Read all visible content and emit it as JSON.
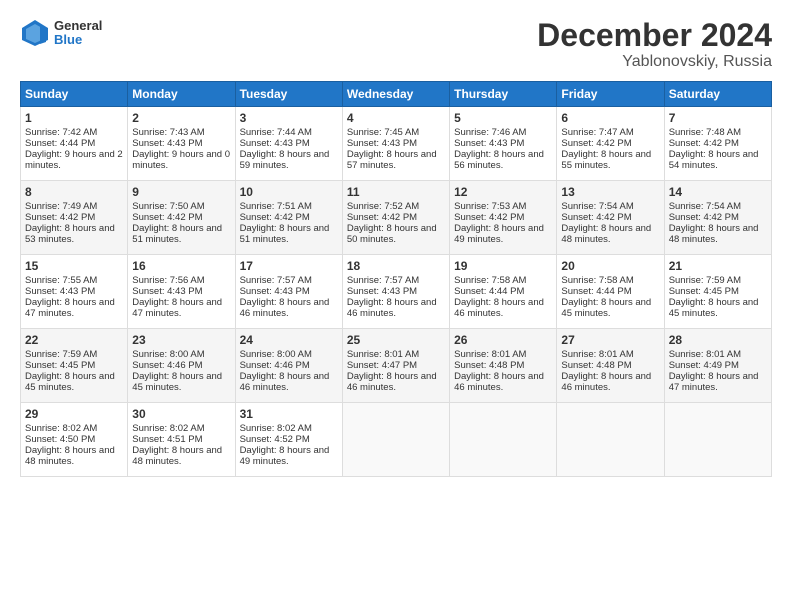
{
  "logo": {
    "line1": "General",
    "line2": "Blue"
  },
  "title": "December 2024",
  "location": "Yablonovskiy, Russia",
  "headers": [
    "Sunday",
    "Monday",
    "Tuesday",
    "Wednesday",
    "Thursday",
    "Friday",
    "Saturday"
  ],
  "weeks": [
    [
      {
        "day": "1",
        "sunrise": "7:42 AM",
        "sunset": "4:44 PM",
        "daylight": "9 hours and 2 minutes."
      },
      {
        "day": "2",
        "sunrise": "7:43 AM",
        "sunset": "4:43 PM",
        "daylight": "9 hours and 0 minutes."
      },
      {
        "day": "3",
        "sunrise": "7:44 AM",
        "sunset": "4:43 PM",
        "daylight": "8 hours and 59 minutes."
      },
      {
        "day": "4",
        "sunrise": "7:45 AM",
        "sunset": "4:43 PM",
        "daylight": "8 hours and 57 minutes."
      },
      {
        "day": "5",
        "sunrise": "7:46 AM",
        "sunset": "4:43 PM",
        "daylight": "8 hours and 56 minutes."
      },
      {
        "day": "6",
        "sunrise": "7:47 AM",
        "sunset": "4:42 PM",
        "daylight": "8 hours and 55 minutes."
      },
      {
        "day": "7",
        "sunrise": "7:48 AM",
        "sunset": "4:42 PM",
        "daylight": "8 hours and 54 minutes."
      }
    ],
    [
      {
        "day": "8",
        "sunrise": "7:49 AM",
        "sunset": "4:42 PM",
        "daylight": "8 hours and 53 minutes."
      },
      {
        "day": "9",
        "sunrise": "7:50 AM",
        "sunset": "4:42 PM",
        "daylight": "8 hours and 51 minutes."
      },
      {
        "day": "10",
        "sunrise": "7:51 AM",
        "sunset": "4:42 PM",
        "daylight": "8 hours and 51 minutes."
      },
      {
        "day": "11",
        "sunrise": "7:52 AM",
        "sunset": "4:42 PM",
        "daylight": "8 hours and 50 minutes."
      },
      {
        "day": "12",
        "sunrise": "7:53 AM",
        "sunset": "4:42 PM",
        "daylight": "8 hours and 49 minutes."
      },
      {
        "day": "13",
        "sunrise": "7:54 AM",
        "sunset": "4:42 PM",
        "daylight": "8 hours and 48 minutes."
      },
      {
        "day": "14",
        "sunrise": "7:54 AM",
        "sunset": "4:42 PM",
        "daylight": "8 hours and 48 minutes."
      }
    ],
    [
      {
        "day": "15",
        "sunrise": "7:55 AM",
        "sunset": "4:43 PM",
        "daylight": "8 hours and 47 minutes."
      },
      {
        "day": "16",
        "sunrise": "7:56 AM",
        "sunset": "4:43 PM",
        "daylight": "8 hours and 47 minutes."
      },
      {
        "day": "17",
        "sunrise": "7:57 AM",
        "sunset": "4:43 PM",
        "daylight": "8 hours and 46 minutes."
      },
      {
        "day": "18",
        "sunrise": "7:57 AM",
        "sunset": "4:43 PM",
        "daylight": "8 hours and 46 minutes."
      },
      {
        "day": "19",
        "sunrise": "7:58 AM",
        "sunset": "4:44 PM",
        "daylight": "8 hours and 46 minutes."
      },
      {
        "day": "20",
        "sunrise": "7:58 AM",
        "sunset": "4:44 PM",
        "daylight": "8 hours and 45 minutes."
      },
      {
        "day": "21",
        "sunrise": "7:59 AM",
        "sunset": "4:45 PM",
        "daylight": "8 hours and 45 minutes."
      }
    ],
    [
      {
        "day": "22",
        "sunrise": "7:59 AM",
        "sunset": "4:45 PM",
        "daylight": "8 hours and 45 minutes."
      },
      {
        "day": "23",
        "sunrise": "8:00 AM",
        "sunset": "4:46 PM",
        "daylight": "8 hours and 45 minutes."
      },
      {
        "day": "24",
        "sunrise": "8:00 AM",
        "sunset": "4:46 PM",
        "daylight": "8 hours and 46 minutes."
      },
      {
        "day": "25",
        "sunrise": "8:01 AM",
        "sunset": "4:47 PM",
        "daylight": "8 hours and 46 minutes."
      },
      {
        "day": "26",
        "sunrise": "8:01 AM",
        "sunset": "4:48 PM",
        "daylight": "8 hours and 46 minutes."
      },
      {
        "day": "27",
        "sunrise": "8:01 AM",
        "sunset": "4:48 PM",
        "daylight": "8 hours and 46 minutes."
      },
      {
        "day": "28",
        "sunrise": "8:01 AM",
        "sunset": "4:49 PM",
        "daylight": "8 hours and 47 minutes."
      }
    ],
    [
      {
        "day": "29",
        "sunrise": "8:02 AM",
        "sunset": "4:50 PM",
        "daylight": "8 hours and 48 minutes."
      },
      {
        "day": "30",
        "sunrise": "8:02 AM",
        "sunset": "4:51 PM",
        "daylight": "8 hours and 48 minutes."
      },
      {
        "day": "31",
        "sunrise": "8:02 AM",
        "sunset": "4:52 PM",
        "daylight": "8 hours and 49 minutes."
      },
      null,
      null,
      null,
      null
    ]
  ]
}
